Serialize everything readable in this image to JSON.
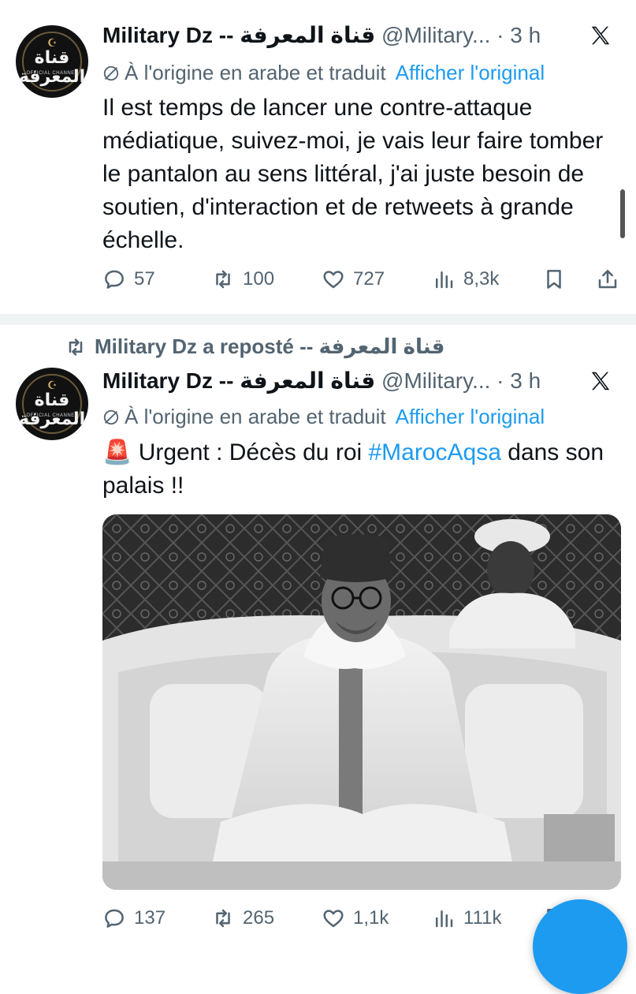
{
  "tweets": [
    {
      "author_name": "Military Dz -- قناة المعرفة",
      "handle": "@Military...",
      "dot": "·",
      "time": "3 h",
      "translation_note": "À l'origine en arabe et traduit",
      "show_original": "Afficher l'original",
      "text": "Il est temps de lancer une contre-attaque médiatique, suivez-moi, je vais leur faire tomber le pantalon au sens littéral, j'ai juste besoin de soutien, d'interaction et de retweets à grande échelle.",
      "replies": "57",
      "reposts": "100",
      "likes": "727",
      "views": "8,3k"
    },
    {
      "repost_label": "Military Dz a reposté -- قناة المعرفة",
      "author_name": "Military Dz -- قناة المعرفة",
      "handle": "@Military...",
      "dot": "·",
      "time": "3 h",
      "translation_note": "À l'origine en arabe et traduit",
      "show_original": "Afficher l'original",
      "text_prefix_emoji": "🚨",
      "text_before_hashtag": "Urgent : Décès du roi ",
      "hashtag": "#MarocAqsa",
      "text_after_hashtag": " dans son palais !!",
      "replies": "137",
      "reposts": "265",
      "likes": "1,1k",
      "views": "111k"
    }
  ],
  "avatar": {
    "logo_text": "قناة المعرفة",
    "logo_sub": "OFFICIAL CHANNEL"
  },
  "icons": {
    "reply": "reply-icon",
    "repost": "repost-icon",
    "like": "heart-icon",
    "views": "views-icon",
    "bookmark": "bookmark-icon",
    "share": "share-icon",
    "x_logo": "x-logo-icon"
  },
  "colors": {
    "link": "#1d9bf0",
    "muted": "#536471",
    "text": "#0f1419"
  }
}
